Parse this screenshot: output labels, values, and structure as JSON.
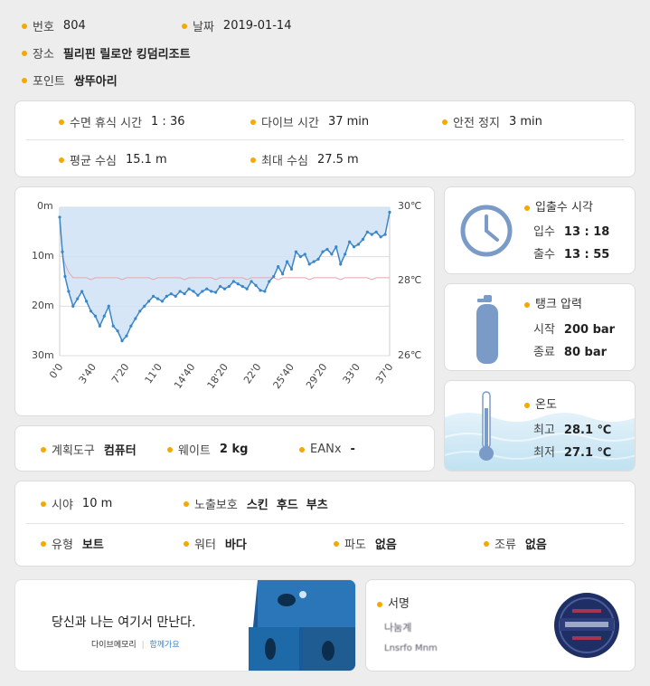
{
  "header": {
    "number_label": "번호",
    "number_value": "804",
    "date_label": "날짜",
    "date_value": "2019-01-14",
    "place_label": "장소",
    "place_value": "필리핀 릴로안 킹덤리조트",
    "point_label": "포인트",
    "point_value": "쌍뚜아리"
  },
  "summary": {
    "surface_interval_label": "수면 휴식 시간",
    "surface_interval_value": "1 : 36",
    "dive_time_label": "다이브 시간",
    "dive_time_value": "37 min",
    "safety_stop_label": "안전 정지",
    "safety_stop_value": "3 min",
    "avg_depth_label": "평균 수심",
    "avg_depth_value": "15.1 m",
    "max_depth_label": "최대 수심",
    "max_depth_value": "27.5 m"
  },
  "profile": {
    "depth_ticks": [
      "0m",
      "10m",
      "20m",
      "30m"
    ],
    "temp_ticks": [
      "30℃",
      "28℃",
      "26℃"
    ],
    "time_ticks": [
      "0'0",
      "3'40",
      "7'20",
      "11'0",
      "14'40",
      "18'20",
      "22'0",
      "25'40",
      "29'20",
      "33'0",
      "37'0"
    ],
    "colors": {
      "depth_line": "#3a86c8",
      "depth_fill": "#cfe2f5",
      "temp_line": "#e6a7ad"
    }
  },
  "chart_data": {
    "type": "area",
    "x_unit": "min",
    "xlim": [
      0,
      37
    ],
    "ylim": [
      0,
      30
    ],
    "y_reversed": true,
    "depth_series": {
      "x": [
        0,
        0.3,
        0.6,
        1,
        1.5,
        2,
        2.5,
        3,
        3.5,
        4,
        4.5,
        5,
        5.5,
        6,
        6.5,
        7,
        7.5,
        8,
        8.5,
        9,
        9.5,
        10,
        10.5,
        11,
        11.5,
        12,
        12.5,
        13,
        13.5,
        14,
        14.5,
        15,
        15.5,
        16,
        16.5,
        17,
        17.5,
        18,
        18.5,
        19,
        19.5,
        20,
        20.5,
        21,
        21.5,
        22,
        22.5,
        23,
        23.5,
        24,
        24.5,
        25,
        25.5,
        26,
        26.5,
        27,
        27.5,
        28,
        28.5,
        29,
        29.5,
        30,
        30.5,
        31,
        31.5,
        32,
        32.5,
        33,
        33.5,
        34,
        34.5,
        35,
        35.5,
        36,
        36.5,
        37
      ],
      "y": [
        2,
        9,
        14,
        17,
        20,
        18.5,
        17,
        19,
        21,
        22,
        24,
        22,
        20,
        24,
        25,
        27,
        26,
        24,
        22.5,
        21,
        20,
        19,
        18,
        18.5,
        19,
        18,
        17.5,
        18,
        17,
        17.5,
        16.5,
        17,
        17.8,
        17,
        16.5,
        17,
        17.2,
        16,
        16.5,
        16,
        15,
        15.5,
        16,
        16.5,
        15,
        15.8,
        16.8,
        17,
        15,
        14,
        12,
        13.5,
        11,
        12.5,
        9,
        10,
        9.5,
        11.5,
        11,
        10.5,
        9,
        8.5,
        9.5,
        8,
        11.5,
        9.5,
        7,
        8,
        7.5,
        6.5,
        5,
        5.5,
        5,
        6,
        5.5,
        1
      ]
    },
    "temp_series": {
      "value_c": 28.1,
      "min_c": 27.1
    }
  },
  "entry_exit": {
    "title": "입출수 시각",
    "in_label": "입수",
    "in_value": "13 : 18",
    "out_label": "출수",
    "out_value": "13 : 55"
  },
  "tank": {
    "title": "탱크 압력",
    "start_label": "시작",
    "start_value": "200 bar",
    "end_label": "종료",
    "end_value": "80 bar"
  },
  "temperature": {
    "title": "온도",
    "high_label": "최고",
    "high_value": "28.1 ℃",
    "low_label": "최저",
    "low_value": "27.1 ℃"
  },
  "gear": {
    "computer_label": "계획도구",
    "computer_value": "컴퓨터",
    "weight_label": "웨이트",
    "weight_value": "2 kg",
    "eanx_label": "EANx",
    "eanx_value": "-"
  },
  "conditions": {
    "visibility_label": "시야",
    "visibility_value": "10 m",
    "exposure_label": "노출보호",
    "exposure_value": "스킨  후드  부츠",
    "type_label": "유형",
    "type_value": "보트",
    "water_label": "워터",
    "water_value": "바다",
    "wave_label": "파도",
    "wave_value": "없음",
    "current_label": "조류",
    "current_value": "없음"
  },
  "banner": {
    "slogan": "당신과 나는 여기서 만난다.",
    "brand": "다이브메모리",
    "tagline": "함께가요"
  },
  "signature": {
    "title": "서명",
    "name_line": "나눔계",
    "sub_line": "Lnsrfo Mnm"
  }
}
